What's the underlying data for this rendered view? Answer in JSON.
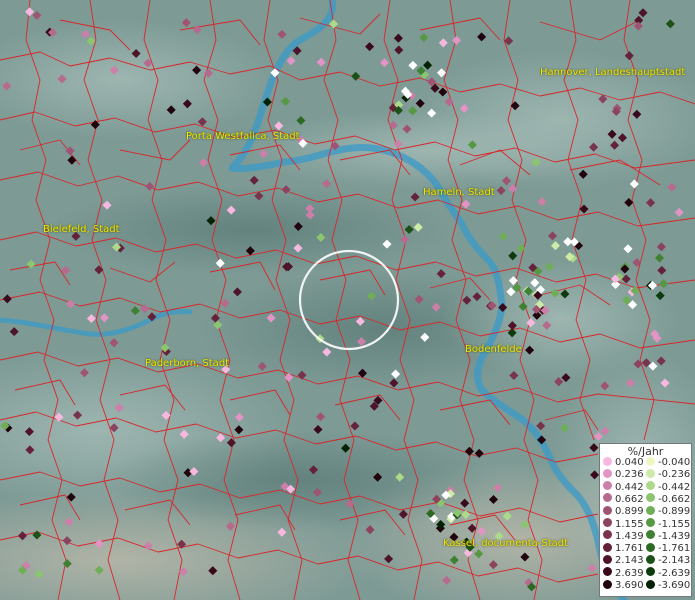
{
  "map": {
    "cities": [
      {
        "label": "Hannover, Landeshauptstadt"
      },
      {
        "label": "Porta Westfalica, Stadt"
      },
      {
        "label": "Hameln, Stadt"
      },
      {
        "label": "Bielefeld, Stadt"
      },
      {
        "label": "Paderborn, Stadt"
      },
      {
        "label": "Bodenfelde"
      },
      {
        "label": "Kassel, documenta-Stadt"
      }
    ]
  },
  "legend": {
    "title": "%/Jahr",
    "positive": [
      {
        "label": "0.040",
        "color": "#f7b8e0"
      },
      {
        "label": "0.236",
        "color": "#e294c4"
      },
      {
        "label": "0.442",
        "color": "#cc7fa8"
      },
      {
        "label": "0.662",
        "color": "#b66a8d"
      },
      {
        "label": "0.899",
        "color": "#a05474"
      },
      {
        "label": "1.155",
        "color": "#8c4360"
      },
      {
        "label": "1.439",
        "color": "#78334d"
      },
      {
        "label": "1.761",
        "color": "#64233b"
      },
      {
        "label": "2.143",
        "color": "#4e152a"
      },
      {
        "label": "2.639",
        "color": "#380a1b"
      },
      {
        "label": "3.690",
        "color": "#20030c"
      }
    ],
    "negative": [
      {
        "label": "-0.040",
        "color": "#ecf8c0"
      },
      {
        "label": "-0.236",
        "color": "#cdeba6"
      },
      {
        "label": "-0.442",
        "color": "#acd98a"
      },
      {
        "label": "-0.662",
        "color": "#8cc56f"
      },
      {
        "label": "-0.899",
        "color": "#6eae57"
      },
      {
        "label": "-1.155",
        "color": "#569843"
      },
      {
        "label": "-1.439",
        "color": "#3f8132"
      },
      {
        "label": "-1.761",
        "color": "#2c6a24"
      },
      {
        "label": "-2.143",
        "color": "#1c5218"
      },
      {
        "label": "-2.639",
        "color": "#0e3b0d"
      },
      {
        "label": "-3.690",
        "color": "#032204"
      }
    ]
  },
  "colors": {
    "border": "#d8262a",
    "river": "#3a9ac8",
    "stable": "#ffffff",
    "label": "#f2e600"
  }
}
